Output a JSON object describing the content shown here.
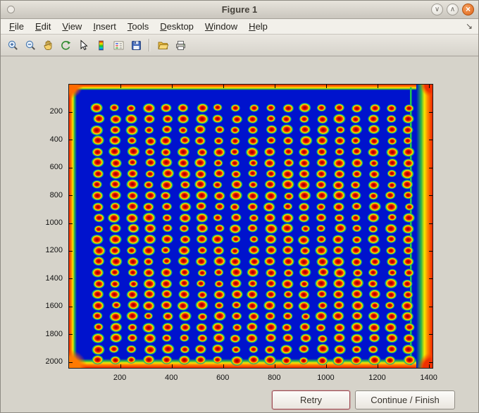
{
  "window": {
    "title": "Figure 1",
    "controls": {
      "minimize": "∨",
      "maximize": "∧",
      "close": "×"
    }
  },
  "menu_bar": {
    "items": [
      {
        "label": "File"
      },
      {
        "label": "Edit"
      },
      {
        "label": "View"
      },
      {
        "label": "Insert"
      },
      {
        "label": "Tools"
      },
      {
        "label": "Desktop"
      },
      {
        "label": "Window"
      },
      {
        "label": "Help"
      }
    ],
    "dock_arrow": "↘"
  },
  "toolbar": {
    "buttons": [
      {
        "name": "zoom-in"
      },
      {
        "name": "zoom-out"
      },
      {
        "name": "pan"
      },
      {
        "name": "rotate-3d"
      },
      {
        "name": "data-cursor"
      },
      {
        "name": "colorbar"
      },
      {
        "name": "legend"
      },
      {
        "name": "save"
      },
      {
        "name": "separator"
      },
      {
        "name": "open"
      },
      {
        "name": "print"
      }
    ]
  },
  "buttons": {
    "retry": "Retry",
    "continue": "Continue / Finish"
  },
  "chart_data": {
    "type": "heatmap",
    "title": "",
    "xlabel": "",
    "ylabel": "",
    "x_range": [
      0,
      1412
    ],
    "y_range": [
      0,
      2040
    ],
    "y_direction": "reverse",
    "x_ticks": [
      200,
      400,
      600,
      800,
      1000,
      1200,
      1400
    ],
    "y_ticks": [
      200,
      400,
      600,
      800,
      1000,
      1200,
      1400,
      1600,
      1800,
      2000
    ],
    "colormap": "jet",
    "description": "Pseudocolor (jet) image of a scanned plate/microarray: regular grid of hot red-yellow spots with green halos on a deep blue field, saturated red-orange bands along all four image edges and a green vertical line just inside the right edge",
    "spots": {
      "rows": 24,
      "cols": 19,
      "x_start": 112,
      "y_start": 168,
      "x_pitch": 67,
      "y_pitch": 79
    },
    "colors": {
      "field_blue": "#0013cd",
      "spot_core": "#8c0000",
      "spot_red": "#f02000",
      "spot_yellow": "#ffe400",
      "spot_green": "#3cc41e",
      "edge_red": "#ee2400",
      "edge_orange": "#ff8800",
      "edge_yellow": "#f6e800",
      "edge_green": "#2cb44a",
      "right_line_green": "#20c850"
    }
  }
}
